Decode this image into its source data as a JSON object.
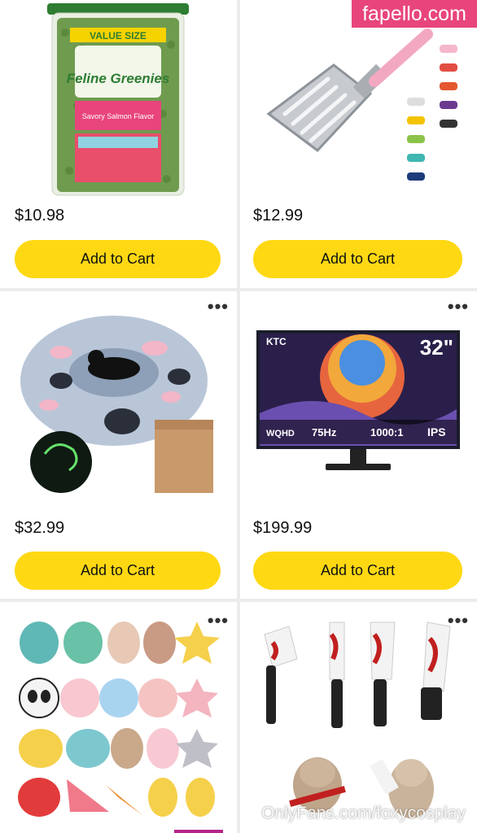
{
  "products": [
    {
      "name": "treats",
      "price": "$10.98",
      "cta": "Add to Cart",
      "brand": "Feline Greenies",
      "badge": "VALUE SIZE",
      "flavor": "Savory Salmon Flavor"
    },
    {
      "name": "scoop",
      "price": "$12.99",
      "cta": "Add to Cart"
    },
    {
      "name": "cat-tunnel-bed",
      "price": "$32.99",
      "cta": "Add to Cart",
      "more": "•••"
    },
    {
      "name": "monitor",
      "price": "$199.99",
      "cta": "Add to Cart",
      "more": "•••",
      "brand": "KTC",
      "size": "32\"",
      "specs": [
        "WQHD",
        "75Hz",
        "1000:1",
        "IPS"
      ]
    },
    {
      "name": "plush-toys",
      "more": "•••"
    },
    {
      "name": "knife-toys",
      "more": "•••"
    }
  ],
  "watermark": {
    "top": "fapello.com",
    "bottom": "OnlyFans.com/foxycosplay"
  },
  "colors": {
    "button": "#ffd814",
    "watermark_bg": "#e8457c",
    "indicator": "#b4238a"
  }
}
